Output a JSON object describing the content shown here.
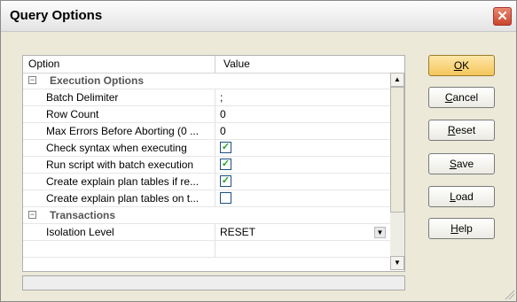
{
  "window": {
    "title": "Query Options",
    "close_glyph": "✕"
  },
  "grid": {
    "columns": [
      "Option",
      "Value"
    ],
    "rows": [
      {
        "type": "category",
        "label": "Execution Options",
        "expander": "⊟"
      },
      {
        "type": "text",
        "label": "Batch Delimiter",
        "value": ";"
      },
      {
        "type": "text",
        "label": "Row Count",
        "value": "0"
      },
      {
        "type": "text",
        "label": "Max Errors Before Aborting (0 ...",
        "value": "0"
      },
      {
        "type": "check",
        "label": "Check syntax when executing",
        "checked": true
      },
      {
        "type": "check",
        "label": "Run script with batch execution",
        "checked": true
      },
      {
        "type": "check",
        "label": "Create explain plan tables if re...",
        "checked": true
      },
      {
        "type": "check",
        "label": "Create explain plan tables on t...",
        "checked": false
      },
      {
        "type": "category",
        "label": "Transactions",
        "expander": "⊟"
      },
      {
        "type": "dropdown",
        "label": "Isolation Level",
        "value": "RESET"
      }
    ]
  },
  "buttons": {
    "ok": {
      "underline": "O",
      "rest": "K"
    },
    "cancel": {
      "underline": "C",
      "rest": "ancel"
    },
    "reset": {
      "underline": "R",
      "rest": "eset"
    },
    "save": {
      "underline": "S",
      "rest": "ave"
    },
    "load": {
      "underline": "L",
      "rest": "oad"
    },
    "help": {
      "underline": "H",
      "rest": "elp"
    }
  },
  "icons": {
    "checkmark": "✓",
    "scroll_up": "▲",
    "scroll_down": "▼",
    "dropdown_arrow": "▼"
  }
}
